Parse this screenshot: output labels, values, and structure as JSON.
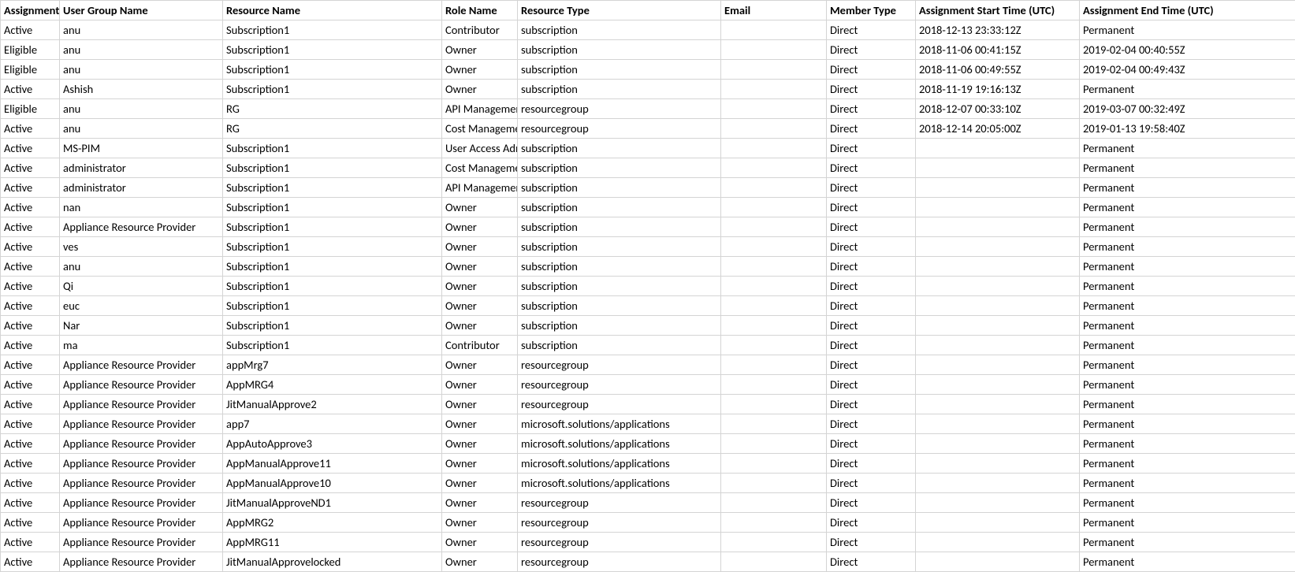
{
  "headers": [
    "Assignment",
    "User Group Name",
    "Resource Name",
    "Role Name",
    "Resource Type",
    "Email",
    "Member Type",
    "Assignment Start Time (UTC)",
    "Assignment End Time (UTC)"
  ],
  "rows": [
    [
      "Active",
      "anu",
      "Subscription1",
      "Contributor",
      "subscription",
      "",
      "Direct",
      "2018-12-13 23:33:12Z",
      "Permanent"
    ],
    [
      "Eligible",
      "anu",
      "Subscription1",
      "Owner",
      "subscription",
      "",
      "Direct",
      "2018-11-06 00:41:15Z",
      "2019-02-04 00:40:55Z"
    ],
    [
      "Eligible",
      "anu",
      "Subscription1",
      "Owner",
      "subscription",
      "",
      "Direct",
      "2018-11-06 00:49:55Z",
      "2019-02-04 00:49:43Z"
    ],
    [
      "Active",
      "Ashish",
      "Subscription1",
      "Owner",
      "subscription",
      "",
      "Direct",
      "2018-11-19 19:16:13Z",
      "Permanent"
    ],
    [
      "Eligible",
      "anu",
      "RG",
      "API Management",
      "resourcegroup",
      "",
      "Direct",
      "2018-12-07 00:33:10Z",
      "2019-03-07 00:32:49Z"
    ],
    [
      "Active",
      "anu",
      "RG",
      "Cost Management",
      "resourcegroup",
      "",
      "Direct",
      "2018-12-14 20:05:00Z",
      "2019-01-13 19:58:40Z"
    ],
    [
      "Active",
      "MS-PIM",
      "Subscription1",
      "User Access Administrator",
      "subscription",
      "",
      "Direct",
      "",
      "Permanent"
    ],
    [
      "Active",
      "administrator",
      "Subscription1",
      "Cost Management",
      "subscription",
      "",
      "Direct",
      "",
      "Permanent"
    ],
    [
      "Active",
      "administrator",
      "Subscription1",
      "API Management",
      "subscription",
      "",
      "Direct",
      "",
      "Permanent"
    ],
    [
      "Active",
      "nan",
      "Subscription1",
      "Owner",
      "subscription",
      "",
      "Direct",
      "",
      "Permanent"
    ],
    [
      "Active",
      "Appliance Resource Provider",
      "Subscription1",
      "Owner",
      "subscription",
      "",
      "Direct",
      "",
      "Permanent"
    ],
    [
      "Active",
      "ves",
      "Subscription1",
      "Owner",
      "subscription",
      "",
      "Direct",
      "",
      "Permanent"
    ],
    [
      "Active",
      "anu",
      "Subscription1",
      "Owner",
      "subscription",
      "",
      "Direct",
      "",
      "Permanent"
    ],
    [
      "Active",
      "Qi",
      "Subscription1",
      "Owner",
      "subscription",
      "",
      "Direct",
      "",
      "Permanent"
    ],
    [
      "Active",
      "euc",
      "Subscription1",
      "Owner",
      "subscription",
      "",
      "Direct",
      "",
      "Permanent"
    ],
    [
      "Active",
      "Nar",
      "Subscription1",
      "Owner",
      "subscription",
      "",
      "Direct",
      "",
      "Permanent"
    ],
    [
      "Active",
      "ma",
      "Subscription1",
      "Contributor",
      "subscription",
      "",
      "Direct",
      "",
      "Permanent"
    ],
    [
      "Active",
      "Appliance Resource Provider",
      "appMrg7",
      "Owner",
      "resourcegroup",
      "",
      "Direct",
      "",
      "Permanent"
    ],
    [
      "Active",
      "Appliance Resource Provider",
      "AppMRG4",
      "Owner",
      "resourcegroup",
      "",
      "Direct",
      "",
      "Permanent"
    ],
    [
      "Active",
      "Appliance Resource Provider",
      "JitManualApprove2",
      "Owner",
      "resourcegroup",
      "",
      "Direct",
      "",
      "Permanent"
    ],
    [
      "Active",
      "Appliance Resource Provider",
      "app7",
      "Owner",
      "microsoft.solutions/applications",
      "",
      "Direct",
      "",
      "Permanent"
    ],
    [
      "Active",
      "Appliance Resource Provider",
      "AppAutoApprove3",
      "Owner",
      "microsoft.solutions/applications",
      "",
      "Direct",
      "",
      "Permanent"
    ],
    [
      "Active",
      "Appliance Resource Provider",
      "AppManualApprove11",
      "Owner",
      "microsoft.solutions/applications",
      "",
      "Direct",
      "",
      "Permanent"
    ],
    [
      "Active",
      "Appliance Resource Provider",
      "AppManualApprove10",
      "Owner",
      "microsoft.solutions/applications",
      "",
      "Direct",
      "",
      "Permanent"
    ],
    [
      "Active",
      "Appliance Resource Provider",
      "JitManualApproveND1",
      "Owner",
      "resourcegroup",
      "",
      "Direct",
      "",
      "Permanent"
    ],
    [
      "Active",
      "Appliance Resource Provider",
      "AppMRG2",
      "Owner",
      "resourcegroup",
      "",
      "Direct",
      "",
      "Permanent"
    ],
    [
      "Active",
      "Appliance Resource Provider",
      "AppMRG11",
      "Owner",
      "resourcegroup",
      "",
      "Direct",
      "",
      "Permanent"
    ],
    [
      "Active",
      "Appliance Resource Provider",
      "JitManualApprovelocked",
      "Owner",
      "resourcegroup",
      "",
      "Direct",
      "",
      "Permanent"
    ]
  ]
}
